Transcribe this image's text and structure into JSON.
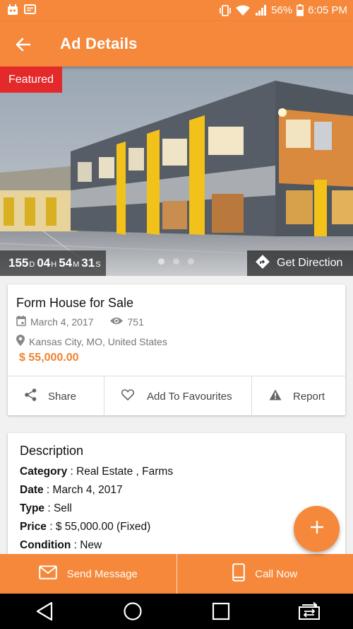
{
  "status_bar": {
    "battery": "56%",
    "time": "6:05 PM"
  },
  "app_bar": {
    "title": "Ad Details"
  },
  "hero": {
    "badge": "Featured",
    "countdown": {
      "days": "155",
      "d_unit": "D",
      "hours": "04",
      "h_unit": "H",
      "minutes": "54",
      "m_unit": "M",
      "seconds": "31",
      "s_unit": "S"
    },
    "direction_label": "Get Direction"
  },
  "ad": {
    "title": "Form House for Sale",
    "date": "March 4, 2017",
    "views": "751",
    "location": "Kansas City, MO, United States",
    "price": "$ 55,000.00"
  },
  "actions": {
    "share": "Share",
    "favourite": "Add To Favourites",
    "report": "Report"
  },
  "description": {
    "heading": "Description",
    "rows": [
      {
        "key": "Category",
        "value": " : Real Estate , Farms"
      },
      {
        "key": "Date",
        "value": " : March 4, 2017"
      },
      {
        "key": "Type",
        "value": " : Sell"
      },
      {
        "key": "Price",
        "value": " : $ 55,000.00 (Fixed)"
      },
      {
        "key": "Condition",
        "value": " : New"
      }
    ]
  },
  "bottom_bar": {
    "send": "Send Message",
    "call": "Call Now"
  },
  "colors": {
    "accent": "#f5883a",
    "featured": "#e4292b",
    "price": "#f0832f"
  }
}
